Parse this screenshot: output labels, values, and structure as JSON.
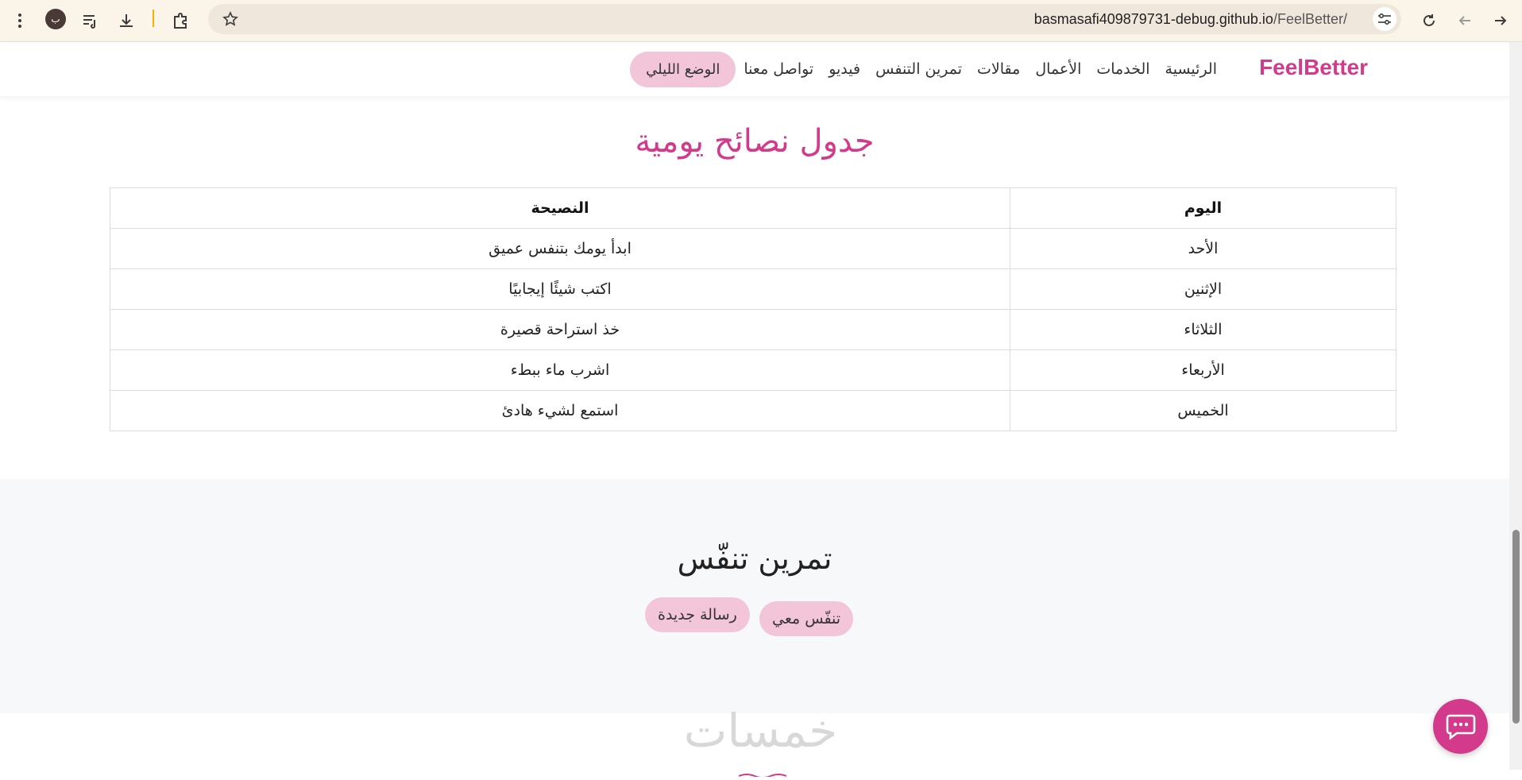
{
  "browser": {
    "avatar_letter": "ب",
    "url_domain": "basmasafi409879731-debug.github.io",
    "url_path": "/FeelBetter/"
  },
  "header": {
    "brand": "FeelBetter",
    "nav": [
      "الرئيسية",
      "الخدمات",
      "الأعمال",
      "مقالات",
      "تمرين التنفس",
      "فيديو",
      "تواصل معنا"
    ],
    "night_mode": "الوضع الليلي"
  },
  "tips_section": {
    "title": "جدول نصائح يومية",
    "columns": [
      "اليوم",
      "النصيحة"
    ],
    "rows": [
      [
        "الأحد",
        "ابدأ يومك بتنفس عميق"
      ],
      [
        "الإثنين",
        "اكتب شيئًا إيجابيًا"
      ],
      [
        "الثلاثاء",
        "خذ استراحة قصيرة"
      ],
      [
        "الأربعاء",
        "اشرب ماء ببطء"
      ],
      [
        "الخميس",
        "استمع لشيء هادئ"
      ]
    ]
  },
  "breathing": {
    "title": "تمرين تنفّس",
    "breathe_button": "تنفّس معي",
    "new_message_button": "رسالة جديدة"
  },
  "watermark": "خمسات",
  "colors": {
    "accent": "#d43a8c",
    "pill": "#f3c5d8"
  }
}
